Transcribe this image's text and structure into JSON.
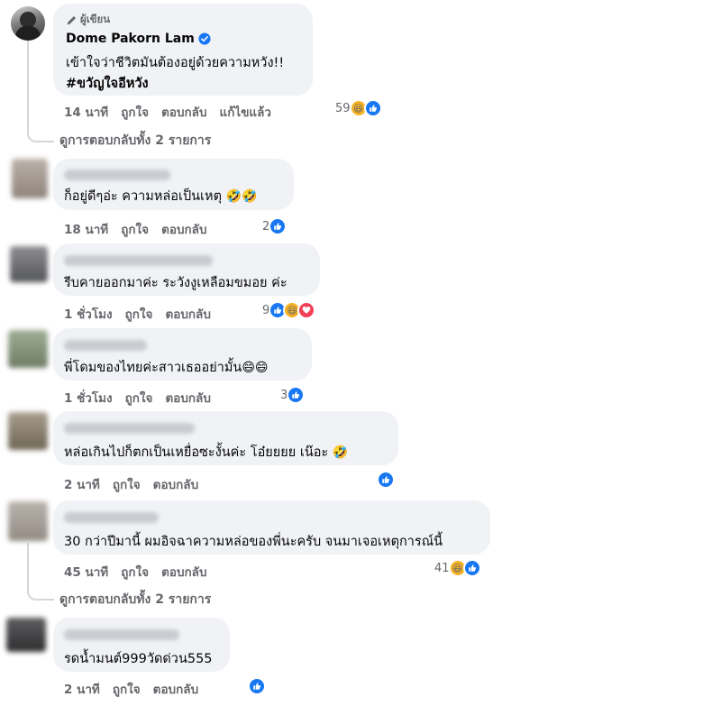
{
  "comments": [
    {
      "author_badge": "ผู้เขียน",
      "author": "Dome Pakorn Lam",
      "text_line1": "เข้าใจว่าชีวิตมันต้องอยู่ด้วยความหวัง!!",
      "text_line2": "#ขวัญใจอีหวัง",
      "time": "14 นาที",
      "like": "ถูกใจ",
      "reply": "ตอบกลับ",
      "edited": "แก้ไขแล้ว",
      "reaction_count": "59",
      "view_replies": "ดูการตอบกลับทั้ง 2 รายการ"
    },
    {
      "text": "ก็อยู่ดีๆอ่ะ ความหล่อเป็นเหตุ",
      "emoji": "🤣🤣",
      "time": "18 นาที",
      "like": "ถูกใจ",
      "reply": "ตอบกลับ",
      "reaction_count": "2"
    },
    {
      "text": "รีบคายออกมาค่ะ ระวังงูเหลือมขมอย ค่ะ",
      "time": "1 ชั่วโมง",
      "like": "ถูกใจ",
      "reply": "ตอบกลับ",
      "reaction_count": "9"
    },
    {
      "text": "พี่โดมของไทยค่ะสาวเธออย่ามั้น",
      "emoji": "😄😄",
      "time": "1 ชั่วโมง",
      "like": "ถูกใจ",
      "reply": "ตอบกลับ",
      "reaction_count": "3"
    },
    {
      "text": "หล่อเกินไปก็ตกเป็นเหยื่อซะงั้นค่ะ โอ๋ยยยย เน๊อะ",
      "emoji": "🤣",
      "time": "2 นาที",
      "like": "ถูกใจ",
      "reply": "ตอบกลับ",
      "reaction_count": ""
    },
    {
      "text": "30 กว่าปีมานี้ ผมอิจฉาความหล่อของพี่นะครับ จนมาเจอเหตุการณ์นี้",
      "time": "45 นาที",
      "like": "ถูกใจ",
      "reply": "ตอบกลับ",
      "reaction_count": "41",
      "view_replies": "ดูการตอบกลับทั้ง 2 รายการ"
    },
    {
      "text": "รดน้ำมนต์999วัดด่วน555",
      "time": "2 นาที",
      "like": "ถูกใจ",
      "reply": "ตอบกลับ",
      "reaction_count": ""
    }
  ],
  "colors": {
    "bubble": "#f0f2f5",
    "meta_text": "#65676b",
    "like_blue": "#1877f2",
    "haha_yellow": "#f7b125",
    "love_red": "#f33e58",
    "verified_blue": "#1877f2"
  },
  "icons": {
    "author_badge": "pencil-icon",
    "verified": "verified-badge-icon",
    "reactions": [
      "like-reaction-icon",
      "haha-reaction-icon",
      "love-reaction-icon"
    ]
  }
}
